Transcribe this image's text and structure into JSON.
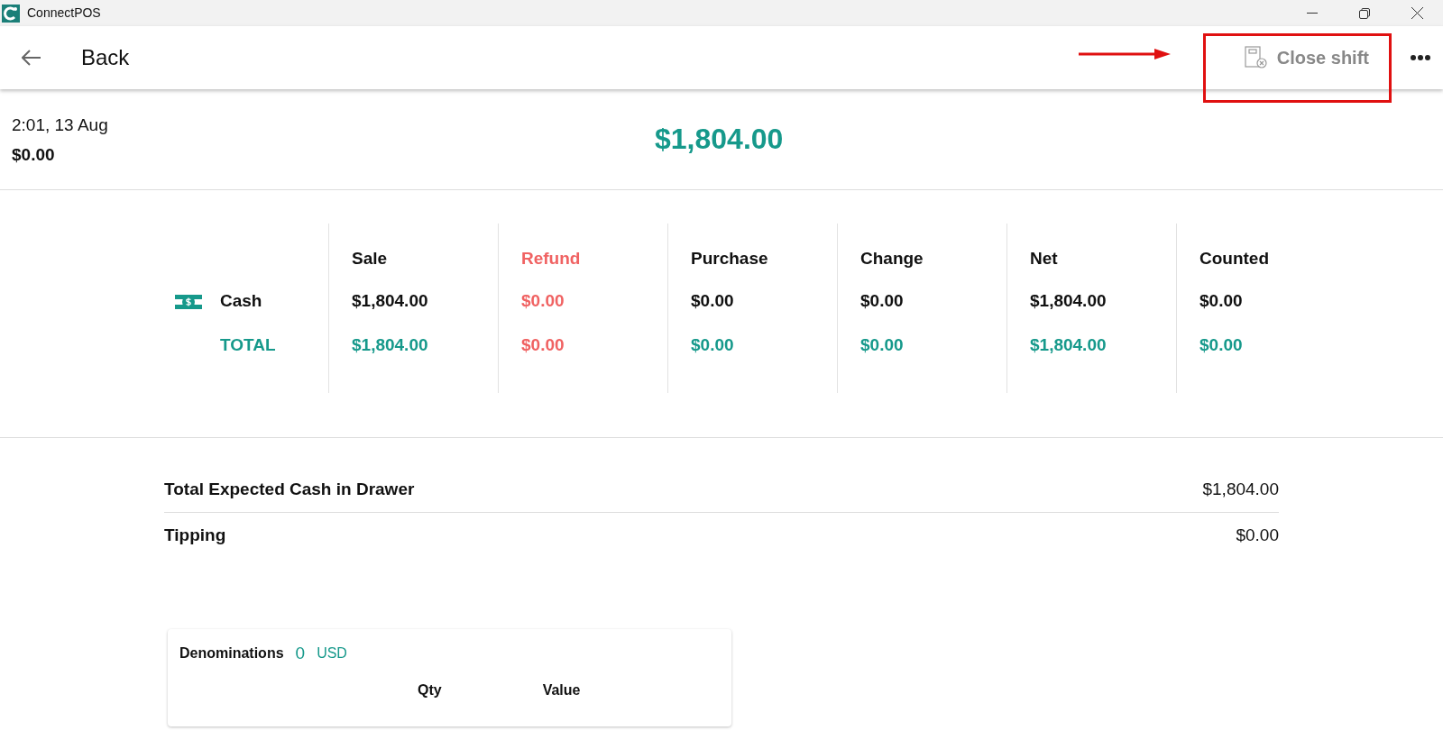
{
  "window": {
    "title": "ConnectPOS"
  },
  "header": {
    "back": "Back",
    "action": "Close shift"
  },
  "shift": {
    "time": "2:01, 13 Aug",
    "opening": "$0.00",
    "total": "$1,804.00"
  },
  "table": {
    "rows": [
      {
        "label": "Cash",
        "kind": "method"
      },
      {
        "label": "TOTAL",
        "kind": "total"
      }
    ],
    "columns": [
      {
        "heading": "Sale",
        "kind": "normal",
        "values": [
          "$1,804.00",
          "$1,804.00"
        ]
      },
      {
        "heading": "Refund",
        "kind": "refund",
        "values": [
          "$0.00",
          "$0.00"
        ]
      },
      {
        "heading": "Purchase",
        "kind": "normal",
        "values": [
          "$0.00",
          "$0.00"
        ]
      },
      {
        "heading": "Change",
        "kind": "normal",
        "values": [
          "$0.00",
          "$0.00"
        ]
      },
      {
        "heading": "Net",
        "kind": "normal",
        "values": [
          "$1,804.00",
          "$1,804.00"
        ]
      },
      {
        "heading": "Counted",
        "kind": "normal",
        "values": [
          "$0.00",
          "$0.00"
        ]
      }
    ]
  },
  "summary": [
    {
      "label": "Total Expected Cash in Drawer",
      "value": "$1,804.00"
    },
    {
      "label": "Tipping",
      "value": "$0.00"
    }
  ],
  "denominations": {
    "title": "Denominations",
    "count": "0",
    "currency": "USD",
    "columns": [
      "Qty",
      "Value"
    ]
  }
}
